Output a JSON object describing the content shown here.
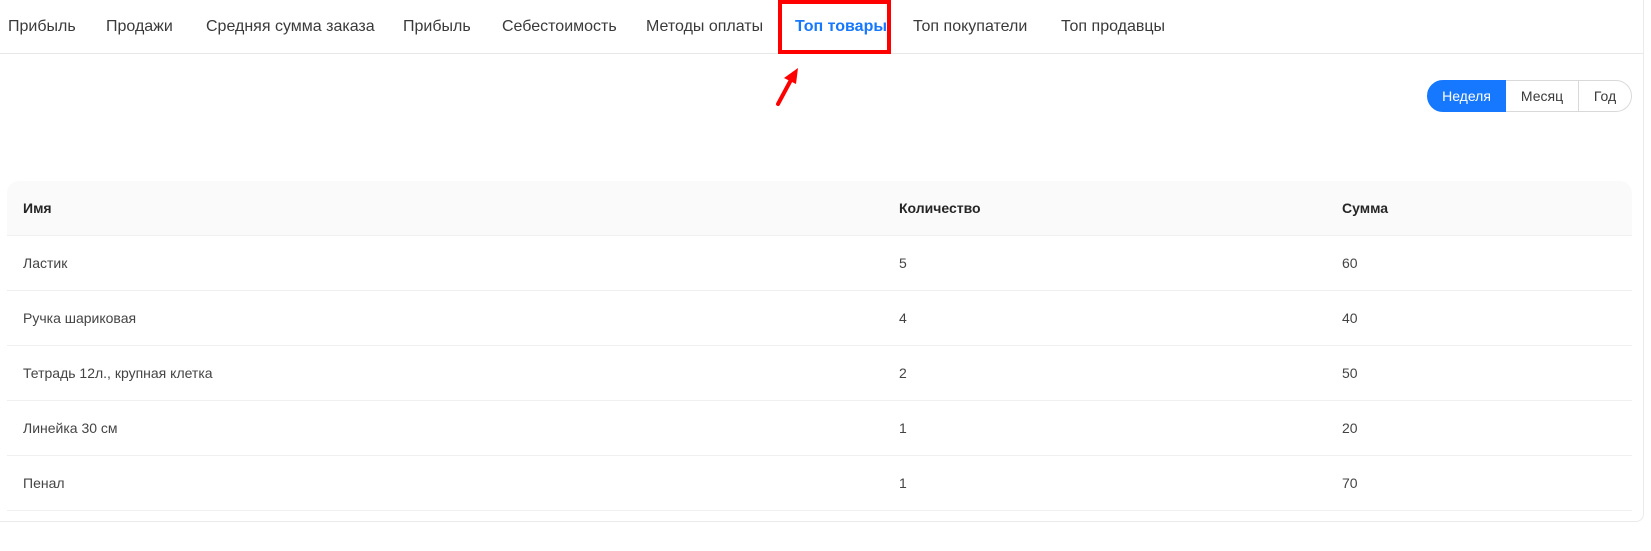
{
  "tabs": [
    {
      "label": "Прибыль"
    },
    {
      "label": "Продажи"
    },
    {
      "label": "Средняя сумма заказа"
    },
    {
      "label": "Прибыль"
    },
    {
      "label": "Себестоимость"
    },
    {
      "label": "Методы оплаты"
    },
    {
      "label": "Топ товары",
      "active": true
    },
    {
      "label": "Топ покупатели"
    },
    {
      "label": "Топ продавцы"
    }
  ],
  "period": {
    "options": [
      "Неделя",
      "Месяц",
      "Год"
    ],
    "selected": "Неделя"
  },
  "table": {
    "columns": [
      "Имя",
      "Количество",
      "Сумма"
    ],
    "rows": [
      [
        "Ластик",
        "5",
        "60"
      ],
      [
        "Ручка шариковая",
        "4",
        "40"
      ],
      [
        "Тетрадь 12л., крупная клетка",
        "2",
        "50"
      ],
      [
        "Линейка 30 см",
        "1",
        "20"
      ],
      [
        "Пенал",
        "1",
        "70"
      ]
    ]
  },
  "colors": {
    "accent": "#1677ff",
    "annotation": "#ff0000"
  },
  "icons": {
    "annotation_arrow": "arrow-icon"
  }
}
